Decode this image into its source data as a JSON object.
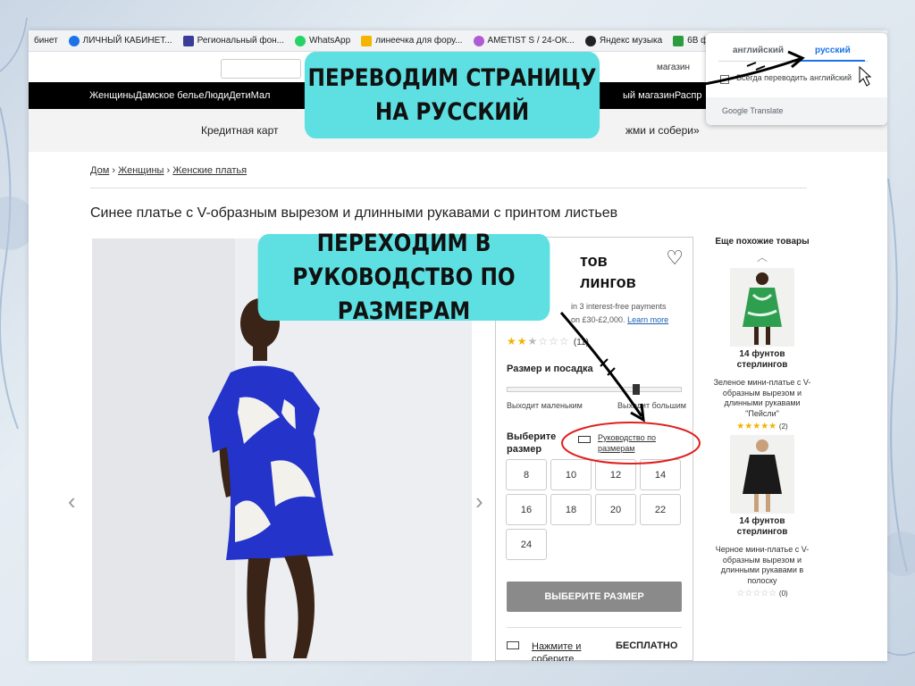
{
  "bookmarks": [
    {
      "label": "бинет",
      "color": "#ffffff"
    },
    {
      "label": "ЛИЧНЫЙ КАБИНЕТ...",
      "color": "#1a73e8"
    },
    {
      "label": "Региональный фон...",
      "color": "#3b3b98"
    },
    {
      "label": "WhatsApp",
      "color": "#25d366"
    },
    {
      "label": "линеечка для фору...",
      "color": "#f4b400"
    },
    {
      "label": "AMETIST S / 24-ОК...",
      "color": "#b05bd6"
    },
    {
      "label": "Яндекс музыка",
      "color": "#222222"
    },
    {
      "label": "6В ф",
      "color": "#2e9c3c"
    }
  ],
  "nav": {
    "left": "ЖенщиныДамское бельеЛюдиДетиМал",
    "right": "ый магазинРаспр"
  },
  "header": {
    "right_text": "магазин"
  },
  "promo": {
    "left": "Кредитная карт",
    "right": "жми и собери»"
  },
  "breadcrumb": {
    "home": "Дом",
    "women": "Женщины",
    "dresses": "Женские платья"
  },
  "product": {
    "title": "Синее платье с V-образным вырезом и длинными рукавами с принтом листьев",
    "price_line1": "тов",
    "price_line2": "лингов",
    "klarna_line1": "in 3 interest-free payments",
    "klarna_line2": "on £30-£2,000.",
    "klarna_link": "Learn more",
    "rating_count": "(11)",
    "fit_label": "Размер и посадка",
    "fit_small": "Выходит маленьким",
    "fit_large": "Выходит большим",
    "choose_size": "Выберите размер",
    "size_guide": "Руководство по размерам",
    "sizes": [
      "8",
      "10",
      "12",
      "14",
      "16",
      "18",
      "20",
      "22",
      "24"
    ],
    "cta": "ВЫБЕРИТЕ РАЗМЕР",
    "pickup": "Нажмите и соберите",
    "free": "БЕСПЛАТНО"
  },
  "similar": {
    "heading": "Еще похожие товары",
    "items": [
      {
        "price": "14 фунтов стерлингов",
        "desc": "Зеленое мини-платье с V-образным вырезом и длинными рукавами \"Пейсли\"",
        "reviews": "(2)",
        "color": "#2e9e4f"
      },
      {
        "price": "14 фунтов стерлингов",
        "desc": "Черное мини-платье с V-образным вырезом и длинными рукавами в полоску",
        "reviews": "(0)",
        "color": "#1a1a1a"
      }
    ]
  },
  "translate": {
    "tab_en": "английский",
    "tab_ru": "русский",
    "always": "Всегда переводить английский",
    "footer": "Google Translate"
  },
  "callouts": {
    "first": "Переводим страницу на русский",
    "second": "Переходим в руководство по размерам"
  },
  "colors": {
    "callout": "#5ee0e3",
    "accent": "#1a73e8",
    "star": "#f1b400",
    "dress_blue": "#2433c9",
    "circle": "#e02020"
  }
}
